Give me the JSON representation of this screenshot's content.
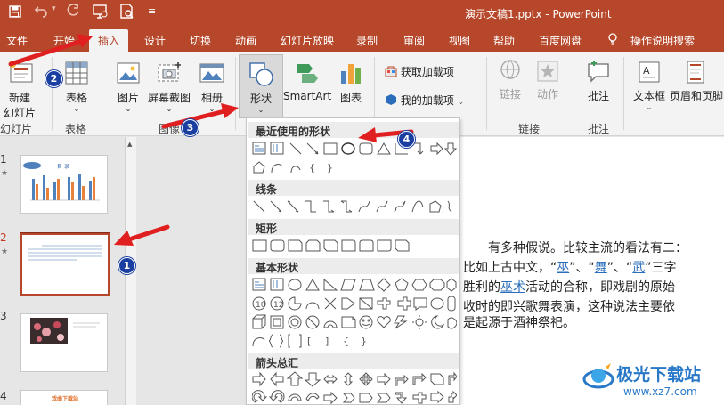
{
  "window": {
    "title": "演示文稿1.pptx  -  PowerPoint"
  },
  "tabs": [
    "文件",
    "开始",
    "插入",
    "设计",
    "切换",
    "动画",
    "幻灯片放映",
    "录制",
    "审阅",
    "视图",
    "帮助",
    "百度网盘",
    "操作说明搜索"
  ],
  "active_tab": "插入",
  "ribbon": {
    "new_slide": "新建\n幻灯片",
    "new_slide_line1": "新建",
    "new_slide_line2": "幻灯片",
    "table": "表格",
    "picture": "图片",
    "screenshot": "屏幕截图",
    "album": "相册",
    "shapes": "形状",
    "smartart": "SmartArt",
    "chart": "图表",
    "get_addins": "获取加载项",
    "my_addins": "我的加载项",
    "link": "链接",
    "action": "动作",
    "comment": "批注",
    "textbox": "文本框",
    "header_footer": "页眉和页脚",
    "groups": {
      "slides": "幻灯片",
      "tables": "表格",
      "images": "图像",
      "links": "链接",
      "comments": "批注"
    }
  },
  "shapes_menu": {
    "sections": [
      "最近使用的形状",
      "线条",
      "矩形",
      "基本形状",
      "箭头总汇"
    ]
  },
  "slides": [
    {
      "number": "1",
      "has_star": true,
      "selected": false,
      "thumb_title": "目  录"
    },
    {
      "number": "2",
      "has_star": true,
      "selected": true
    },
    {
      "number": "3",
      "has_star": false,
      "selected": false
    },
    {
      "number": "4",
      "has_star": false,
      "selected": false,
      "thumb_title": "戏曲下载站"
    }
  ],
  "slide_text": {
    "line1": "有多种假说。比较主流的看法有二：",
    "line2_pre": "比如上古中文，“",
    "line2_w1": "巫",
    "line2_mid1": "”、“",
    "line2_w2": "舞",
    "line2_mid2": "”、“",
    "line2_w3": "武",
    "line2_post": "”三字",
    "line3_pre": "胜利的",
    "line3_link": "巫术",
    "line3_post": "活动的合称，即戏剧的原始",
    "line4": "收时的即兴歌舞表演，这种说法主要依",
    "line5": "是起源于酒神祭祀。"
  },
  "annotations": [
    "1",
    "2",
    "3",
    "4"
  ],
  "watermark": {
    "name": "极光下载站",
    "url": "www.xz7.com"
  },
  "colors": {
    "accent": "#b7472a",
    "arrow": "#e02020",
    "badge": "#1a3fa0",
    "link": "#2a6ebb"
  }
}
